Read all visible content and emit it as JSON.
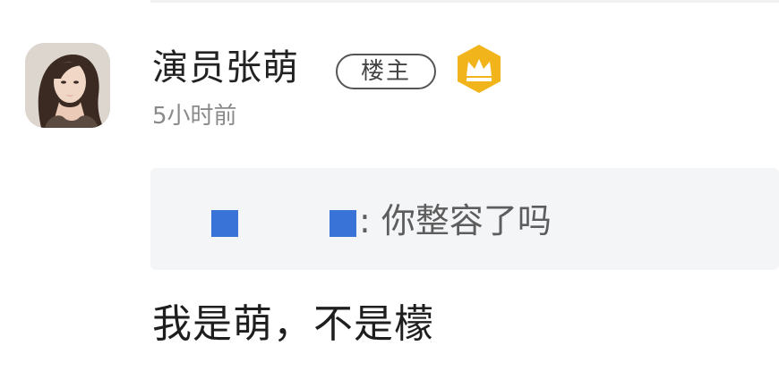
{
  "comment": {
    "author": "演员张萌",
    "owner_badge": "楼主",
    "time": "5小时前",
    "quote": {
      "separator_and_text": ": 你整容了吗"
    },
    "reply": "我是萌，不是檬"
  },
  "icons": {
    "avatar": "user-avatar-photo",
    "crown": "crown-icon"
  },
  "colors": {
    "crown_badge": "#F2B41B",
    "redaction": "#3A73D8",
    "quote_background": "#F4F5F7"
  }
}
